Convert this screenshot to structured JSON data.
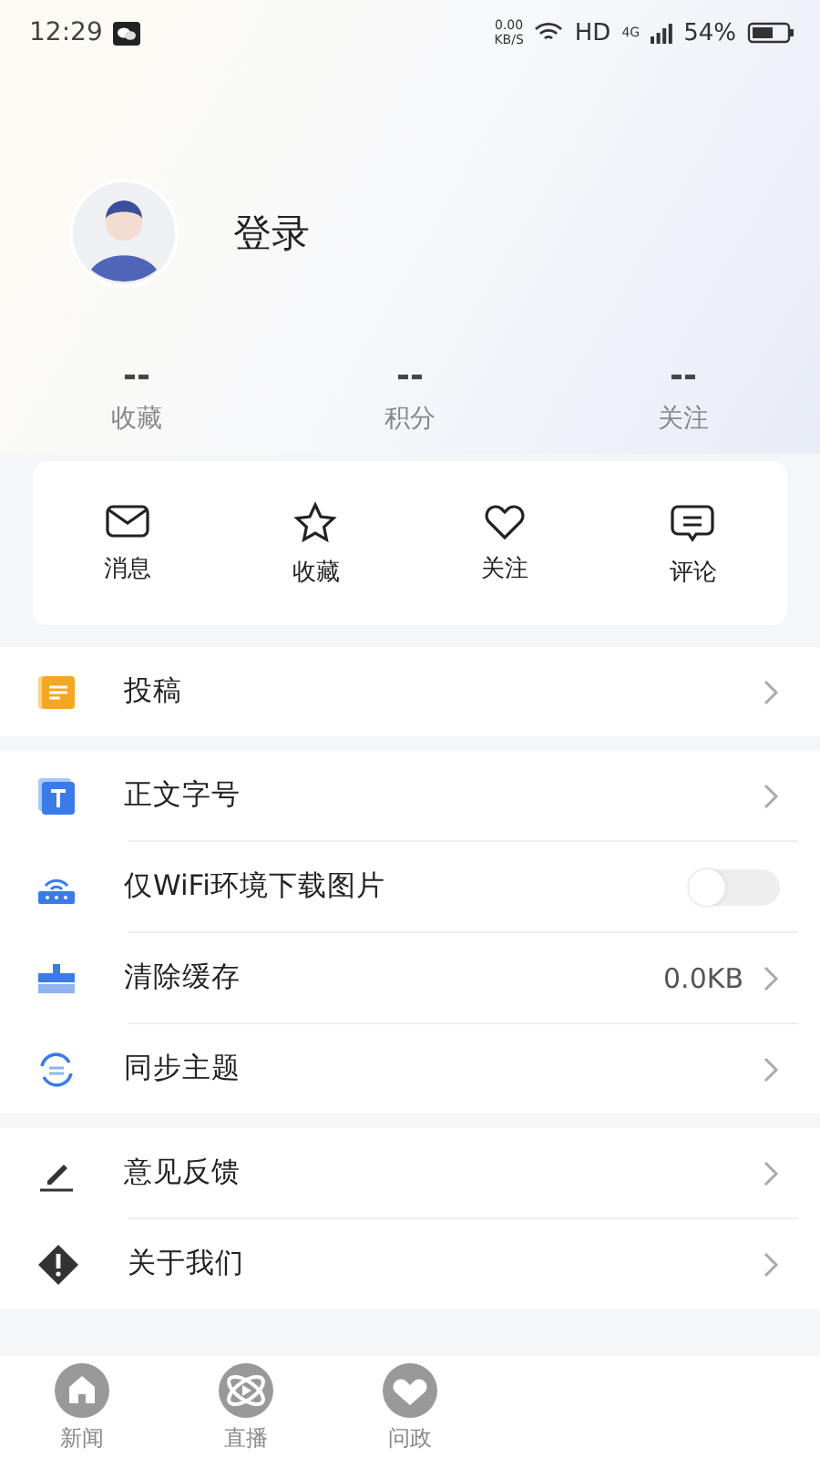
{
  "status_bar": {
    "time": "12:29",
    "net_speed": "0.00",
    "net_unit": "KB/S",
    "hd": "HD",
    "network": "4G",
    "battery": "54%"
  },
  "profile": {
    "login": "登录"
  },
  "stats": [
    {
      "value": "--",
      "label": "收藏"
    },
    {
      "value": "--",
      "label": "积分"
    },
    {
      "value": "--",
      "label": "关注"
    }
  ],
  "actions": [
    {
      "kind": "mail",
      "label": "消息"
    },
    {
      "kind": "star",
      "label": "收藏"
    },
    {
      "kind": "heart",
      "label": "关注"
    },
    {
      "kind": "comment",
      "label": "评论"
    }
  ],
  "groups": [
    [
      {
        "kind": "contribute",
        "label": "投稿"
      }
    ],
    [
      {
        "kind": "font",
        "label": "正文字号"
      },
      {
        "kind": "wifi",
        "label": "仅WiFi环境下载图片",
        "on": false
      },
      {
        "kind": "cache",
        "label": "清除缓存",
        "value": "0.0KB"
      },
      {
        "kind": "sync",
        "label": "同步主题"
      }
    ],
    [
      {
        "kind": "feedback",
        "label": "意见反馈"
      },
      {
        "kind": "about",
        "label": "关于我们"
      }
    ]
  ],
  "nav": [
    {
      "kind": "home",
      "label": "新闻"
    },
    {
      "kind": "live",
      "label": "直播"
    },
    {
      "kind": "ask",
      "label": "问政"
    }
  ]
}
